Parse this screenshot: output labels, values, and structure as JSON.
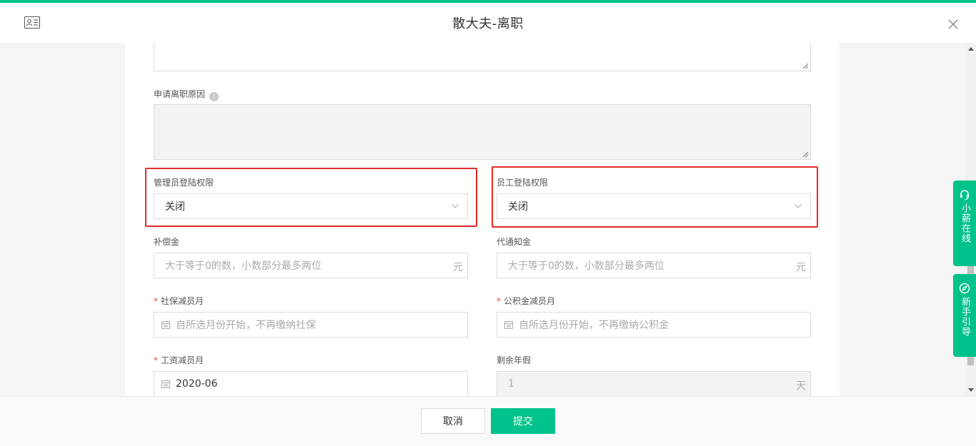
{
  "header": {
    "title": "散大夫-离职"
  },
  "form": {
    "reason_label": "申请离职原因",
    "reason_info": "!",
    "admin_login": {
      "label": "管理员登陆权限",
      "value": "关闭"
    },
    "staff_login": {
      "label": "员工登陆权限",
      "value": "关闭"
    },
    "compensation": {
      "label": "补偿金",
      "placeholder": "大于等于0的数，小数部分最多两位",
      "suffix": "元"
    },
    "notice_pay": {
      "label": "代通知金",
      "placeholder": "大于等于0的数，小数部分最多两位",
      "suffix": "元"
    },
    "social_month": {
      "required": "*",
      "label": "社保减员月",
      "placeholder": "自所选月份开始，不再缴纳社保"
    },
    "fund_month": {
      "required": "*",
      "label": "公积金减员月",
      "placeholder": "自所选月份开始，不再缴纳公积金"
    },
    "salary_month": {
      "required": "*",
      "label": "工资减员月",
      "value": "2020-06"
    },
    "annual_leave": {
      "label": "剩余年假",
      "value": "1",
      "suffix": "天"
    }
  },
  "side_tabs": {
    "online": "小薪在线",
    "guide": "新手引导"
  },
  "footer": {
    "cancel_label": "取消",
    "submit_label": "提交"
  },
  "colors": {
    "accent": "#00c28a",
    "highlight": "#e02a2a"
  }
}
